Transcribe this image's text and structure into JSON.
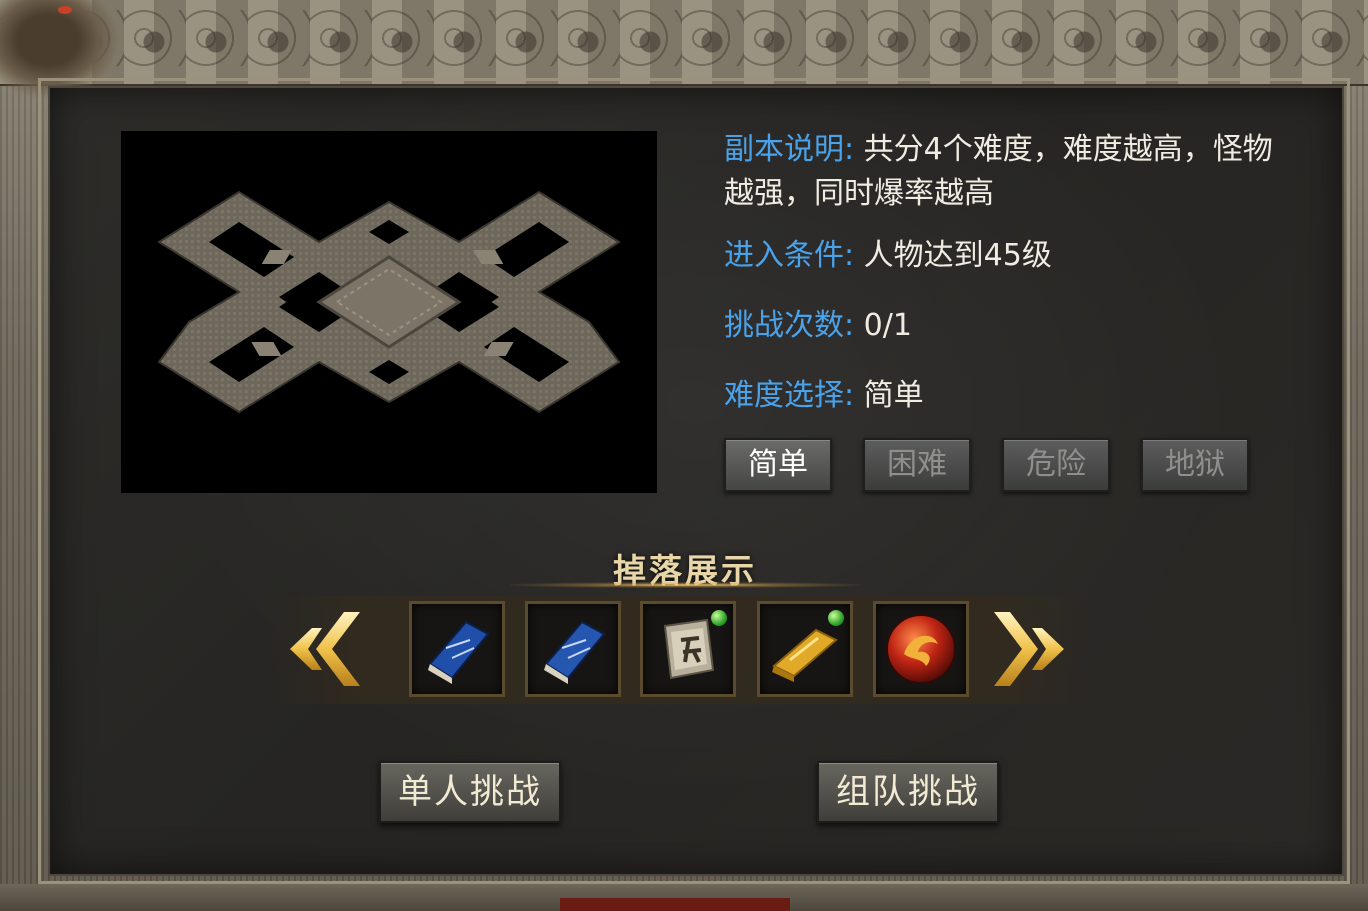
{
  "dungeon": {
    "description_label": "副本说明:",
    "description_text": "共分4个难度，难度越高，怪物越强，同时爆率越高",
    "entry_label": "进入条件:",
    "entry_value": "人物达到45级",
    "attempts_label": "挑战次数:",
    "attempts_value": "0/1",
    "difficulty_label": "难度选择:",
    "difficulty_value": "简单"
  },
  "difficulties": [
    {
      "label": "简单",
      "selected": true
    },
    {
      "label": "困难",
      "selected": false
    },
    {
      "label": "危险",
      "selected": false
    },
    {
      "label": "地狱",
      "selected": false
    }
  ],
  "drops": {
    "title": "掉落展示",
    "items": [
      {
        "icon": "blue-book-icon",
        "gem": false
      },
      {
        "icon": "blue-book-icon",
        "gem": false
      },
      {
        "icon": "rune-tablet-icon",
        "gem": true
      },
      {
        "icon": "gold-bar-icon",
        "gem": true
      },
      {
        "icon": "red-dragon-orb-icon",
        "gem": false
      }
    ]
  },
  "actions": {
    "solo_label": "单人挑战",
    "team_label": "组队挑战"
  },
  "colors": {
    "label_blue": "#4aa3ea",
    "text_white": "#f1ece2",
    "gold": "#e9d6a8"
  }
}
